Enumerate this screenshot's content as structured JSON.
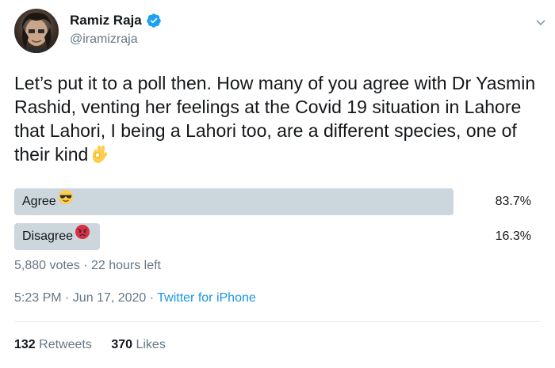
{
  "user": {
    "display_name": "Ramiz Raja",
    "handle": "@iramizraja"
  },
  "tweet": {
    "text": "Let’s put it to a poll then. How many of you agree with Dr Yasmin Rashid, venting her feelings at the Covid 19 situation in Lahore that Lahori, I being a Lahori too, are a different species, one of their kind",
    "trailing_emoji": "ok-hand-emoji"
  },
  "poll": {
    "options": [
      {
        "label": "Agree",
        "emoji": "sunglasses-face-emoji",
        "percent_text": "83.7%",
        "percent": 83.7
      },
      {
        "label": "Disagree",
        "emoji": "angry-face-emoji",
        "percent_text": "16.3%",
        "percent": 16.3
      }
    ],
    "meta": "5,880 votes · 22 hours left"
  },
  "timestamp": {
    "time_date": "5:23 PM · Jun 17, 2020 · ",
    "source": "Twitter for iPhone"
  },
  "stats": {
    "retweets_count": "132",
    "retweets_label": "Retweets",
    "likes_count": "370",
    "likes_label": "Likes"
  },
  "colors": {
    "bar": "#ccd6dd",
    "link": "#1b95e0",
    "muted": "#657786",
    "verified": "#1da1f2"
  }
}
